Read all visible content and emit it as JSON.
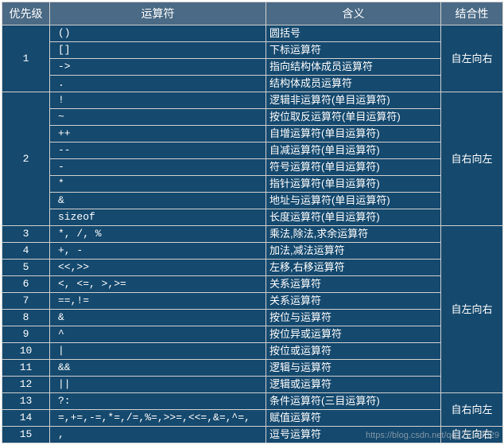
{
  "headers": {
    "priority": "优先级",
    "operator": "运算符",
    "meaning": "含义",
    "assoc": "结合性"
  },
  "groups": [
    {
      "priority": "1",
      "assoc": "自左向右",
      "rows": [
        {
          "op": "()",
          "meaning": "圆括号"
        },
        {
          "op": "[]",
          "meaning": "下标运算符"
        },
        {
          "op": "->",
          "meaning": "指向结构体成员运算符"
        },
        {
          "op": ".",
          "meaning": "结构体成员运算符"
        }
      ]
    },
    {
      "priority": "2",
      "assoc": "自右向左",
      "rows": [
        {
          "op": "!",
          "meaning": "逻辑非运算符(单目运算符)"
        },
        {
          "op": "~",
          "meaning": "按位取反运算符(单目运算符)"
        },
        {
          "op": "++",
          "meaning": "自增运算符(单目运算符)"
        },
        {
          "op": "--",
          "meaning": "自减运算符(单目运算符)"
        },
        {
          "op": "-",
          "meaning": "符号运算符(单目运算符)"
        },
        {
          "op": "*",
          "meaning": "指针运算符(单目运算符)"
        },
        {
          "op": "&",
          "meaning": "地址与运算符(单目运算符)"
        },
        {
          "op": "sizeof",
          "meaning": "长度运算符(单目运算符)"
        }
      ]
    }
  ],
  "group3": {
    "assoc": "自左向右",
    "rows": [
      {
        "priority": "3",
        "op": "*, /, %",
        "meaning": "乘法,除法,求余运算符"
      },
      {
        "priority": "4",
        "op": "+, -",
        "meaning": "加法,减法运算符"
      },
      {
        "priority": "5",
        "op": "<<,>>",
        "meaning": "左移,右移运算符"
      },
      {
        "priority": "6",
        "op": "<, <=, >,>=",
        "meaning": "关系运算符"
      },
      {
        "priority": "7",
        "op": "==,!=",
        "meaning": "关系运算符"
      },
      {
        "priority": "8",
        "op": "&",
        "meaning": "按位与运算符"
      },
      {
        "priority": "9",
        "op": "^",
        "meaning": "按位异或运算符"
      },
      {
        "priority": "10",
        "op": "|",
        "meaning": "按位或运算符"
      },
      {
        "priority": "11",
        "op": "&&",
        "meaning": "逻辑与运算符"
      },
      {
        "priority": "12",
        "op": "||",
        "meaning": "逻辑或运算符"
      }
    ]
  },
  "group4": {
    "assoc": "自右向左",
    "rows": [
      {
        "priority": "13",
        "op": "?:",
        "meaning": "条件运算符(三目运算符)"
      },
      {
        "priority": "14",
        "op": "=,+=,-=,*=,/=,%=,>>=,<<=,&=,^=,",
        "meaning": "赋值运算符"
      }
    ]
  },
  "group5": {
    "assoc": "自左向右",
    "rows": [
      {
        "priority": "15",
        "op": ",",
        "meaning": "逗号运算符"
      }
    ]
  },
  "watermark": "https://blog.csdn.net/qq_25113329"
}
